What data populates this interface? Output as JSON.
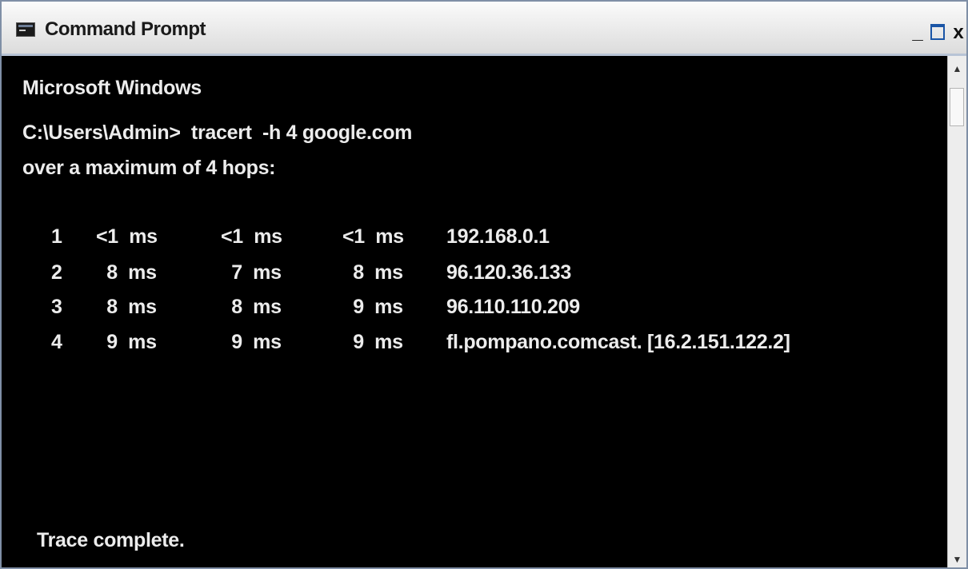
{
  "window": {
    "title": "Command Prompt",
    "controls": {
      "minimize": "_",
      "close": "x"
    }
  },
  "console": {
    "header": "Microsoft Windows",
    "prompt": "C:\\Users\\Admin>  tracert  -h 4 google.com",
    "max_hops": "over a maximum of 4 hops:",
    "hops": [
      {
        "num": "1",
        "t1": "<1  ms",
        "t2": "<1  ms",
        "t3": "<1  ms",
        "host": "192.168.0.1"
      },
      {
        "num": "2",
        "t1": "  8  ms",
        "t2": "  7  ms",
        "t3": "  8  ms",
        "host": "96.120.36.133"
      },
      {
        "num": "3",
        "t1": "  8  ms",
        "t2": "  8  ms",
        "t3": "  9  ms",
        "host": "96.110.110.209"
      },
      {
        "num": "4",
        "t1": "  9  ms",
        "t2": "  9  ms",
        "t3": "  9  ms",
        "host": "fl.pompano.comcast. [16.2.151.122.2]"
      }
    ],
    "footer": "Trace complete."
  },
  "scrollbar": {
    "up_icon": "arrow-up-icon",
    "down_icon": "arrow-down-icon"
  },
  "colors": {
    "console_bg": "#000000",
    "console_fg": "#ececec",
    "titlebar_bg": "#e8e8e8"
  }
}
